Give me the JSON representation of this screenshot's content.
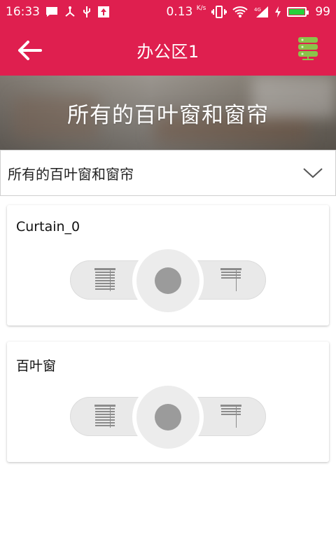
{
  "status_bar": {
    "time": "16:33",
    "speed": "0.13",
    "speed_unit": "K/s",
    "battery_level": "99",
    "icons": [
      "message-icon",
      "usb-share-icon",
      "usb-icon",
      "upload-icon",
      "vibrate-icon",
      "wifi-icon",
      "signal-4g-icon",
      "charging-icon",
      "battery-icon"
    ]
  },
  "app_bar": {
    "title": "办公区1",
    "back_icon": "arrow-left-icon",
    "server_icon": "server-icon",
    "accent_color": "#df1f4f",
    "server_icon_color": "#8bc34a"
  },
  "banner": {
    "title": "所有的百叶窗和窗帘"
  },
  "dropdown": {
    "selected": "所有的百叶窗和窗帘",
    "icon": "chevron-down-icon"
  },
  "devices": [
    {
      "name": "Curtain_0",
      "open_icon": "blinds-open-icon",
      "stop_icon": "stop-icon",
      "close_icon": "blinds-close-icon"
    },
    {
      "name": "百叶窗",
      "open_icon": "blinds-open-icon",
      "stop_icon": "stop-icon",
      "close_icon": "blinds-close-icon"
    }
  ]
}
